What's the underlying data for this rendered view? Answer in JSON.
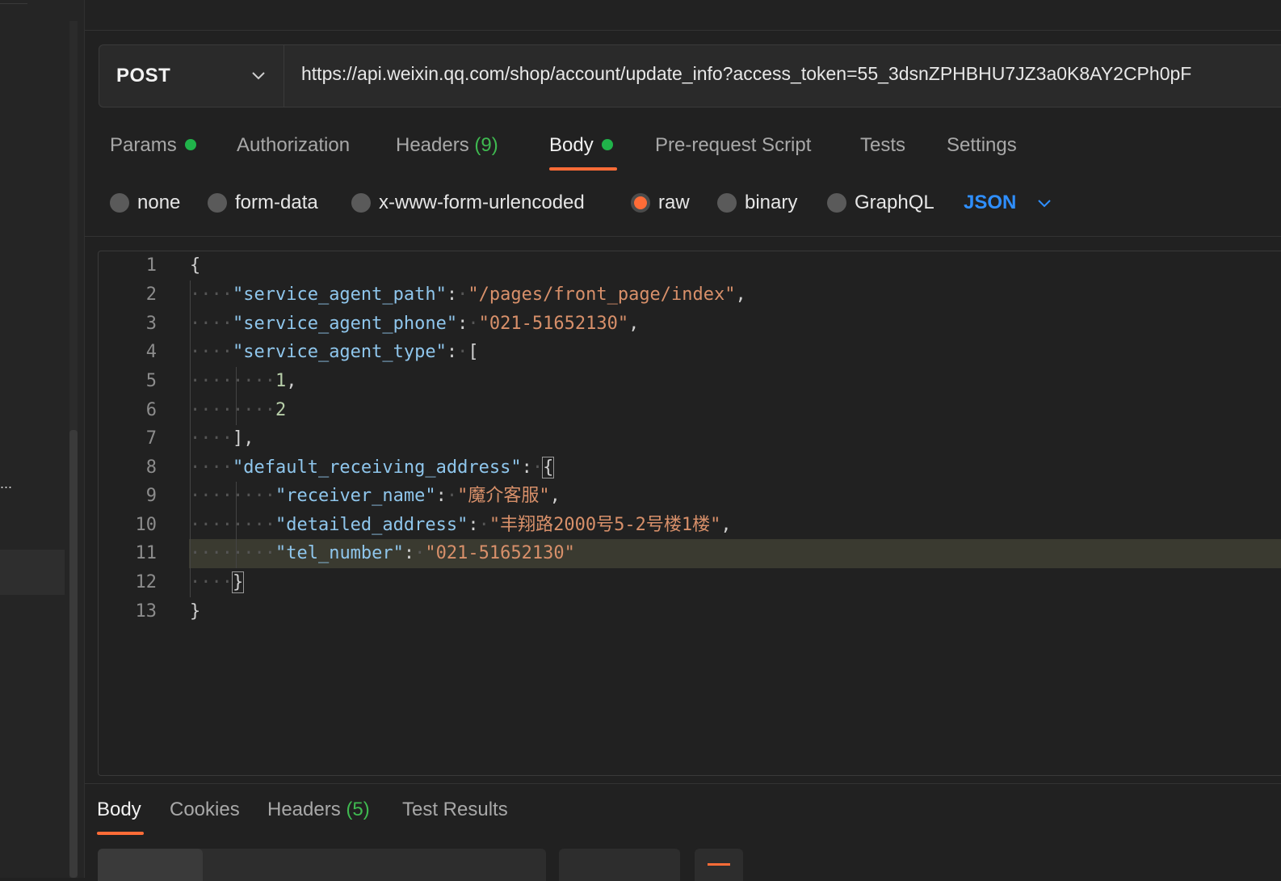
{
  "request": {
    "method": "POST",
    "url": "https://api.weixin.qq.com/shop/account/update_info?access_token=55_3dsnZPHBHU7JZ3a0K8AY2CPh0pF"
  },
  "tabs": [
    {
      "label": "Params",
      "dot": true
    },
    {
      "label": "Authorization"
    },
    {
      "label": "Headers",
      "count": "(9)"
    },
    {
      "label": "Body",
      "dot": true,
      "active": true
    },
    {
      "label": "Pre-request Script"
    },
    {
      "label": "Tests"
    },
    {
      "label": "Settings"
    }
  ],
  "body_types": [
    {
      "label": "none",
      "selected": false
    },
    {
      "label": "form-data",
      "selected": false
    },
    {
      "label": "x-www-form-urlencoded",
      "selected": false
    },
    {
      "label": "raw",
      "selected": true
    },
    {
      "label": "binary",
      "selected": false
    },
    {
      "label": "GraphQL",
      "selected": false
    }
  ],
  "language": "JSON",
  "editor": {
    "line_numbers": [
      "1",
      "2",
      "3",
      "4",
      "5",
      "6",
      "7",
      "8",
      "9",
      "10",
      "11",
      "12",
      "13"
    ],
    "highlighted_line": 11,
    "code": {
      "l1": "{",
      "k2": "\"service_agent_path\"",
      "v2": "\"/pages/front_page/index\"",
      "k3": "\"service_agent_phone\"",
      "v3": "\"021-51652130\"",
      "k4": "\"service_agent_type\"",
      "v4": "[",
      "v5": "1",
      "v6": "2",
      "l7": "]",
      "k8": "\"default_receiving_address\"",
      "v8": "{",
      "k9": "\"receiver_name\"",
      "v9": "\"魔介客服\"",
      "k10": "\"detailed_address\"",
      "v10": "\"丰翔路2000号5-2号楼1楼\"",
      "k11": "\"tel_number\"",
      "v11": "\"021-51652130\"",
      "l12": "}",
      "l13": "}"
    }
  },
  "response_tabs": [
    {
      "label": "Body",
      "active": true
    },
    {
      "label": "Cookies"
    },
    {
      "label": "Headers",
      "count": "(5)"
    },
    {
      "label": "Test Results"
    }
  ],
  "sidebar": {
    "ellipsis": "..."
  },
  "colors": {
    "accent": "#ff6c37",
    "dot_green": "#20b34a",
    "link_blue": "#2f8fff"
  }
}
